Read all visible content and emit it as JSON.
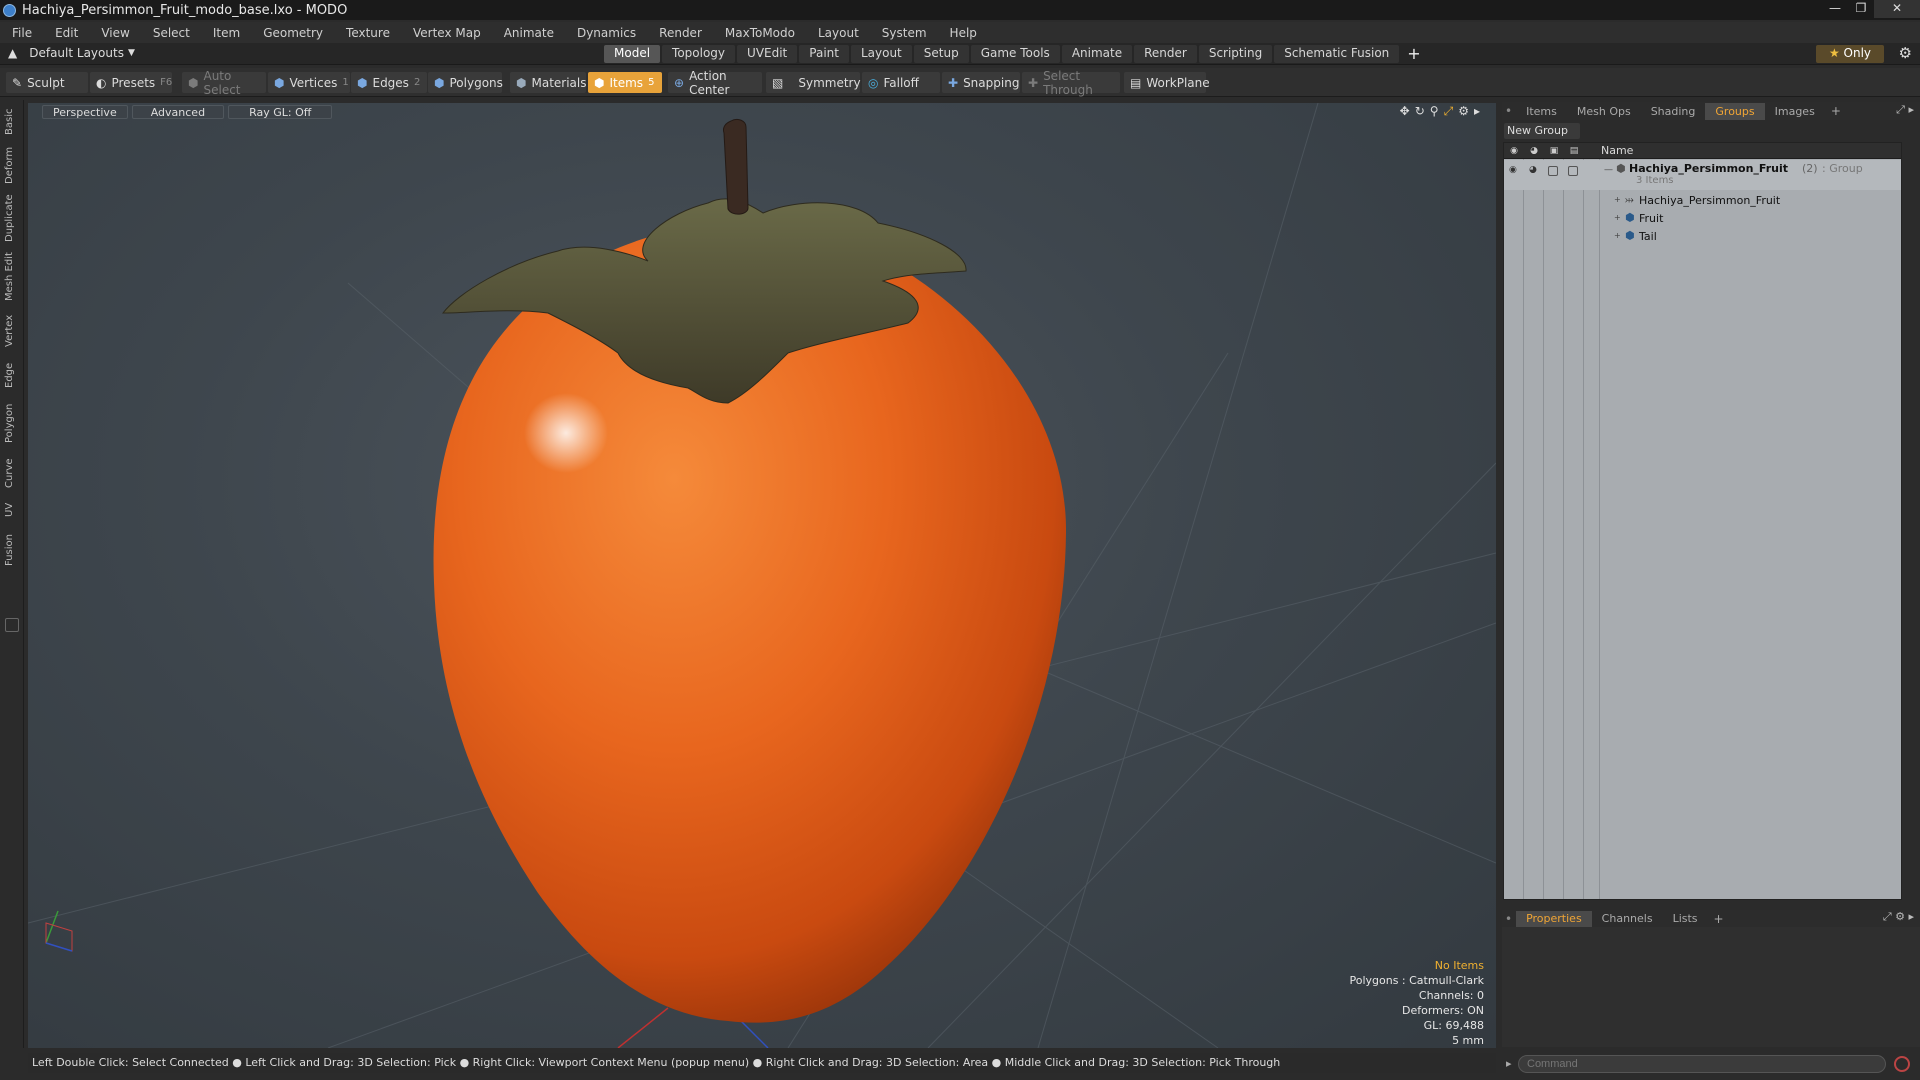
{
  "window": {
    "title": "Hachiya_Persimmon_Fruit_modo_base.lxo - MODO"
  },
  "menu": [
    "File",
    "Edit",
    "View",
    "Select",
    "Item",
    "Geometry",
    "Texture",
    "Vertex Map",
    "Animate",
    "Dynamics",
    "Render",
    "MaxToModo",
    "Layout",
    "System",
    "Help"
  ],
  "layouts": {
    "dropdown": "Default Layouts",
    "tabs": [
      "Model",
      "Topology",
      "UVEdit",
      "Paint",
      "Layout",
      "Setup",
      "Game Tools",
      "Animate",
      "Render",
      "Scripting",
      "Schematic Fusion"
    ],
    "active_tab": "Model",
    "only_label": "Only"
  },
  "toolbar": {
    "sculpt": "Sculpt",
    "presets": "Presets",
    "presets_key": "F6",
    "auto_select": "Auto Select",
    "vertices": "Vertices",
    "vertices_key": "1",
    "edges": "Edges",
    "edges_key": "2",
    "polygons": "Polygons",
    "materials": "Materials",
    "items": "Items",
    "items_key": "5",
    "action_center": "Action Center",
    "symmetry": "Symmetry",
    "falloff": "Falloff",
    "snapping": "Snapping",
    "select_through": "Select Through",
    "workplane": "WorkPlane"
  },
  "left_tabs": [
    "Basic",
    "Deform",
    "Duplicate",
    "Mesh Edit",
    "Vertex",
    "Edge",
    "Polygon",
    "Curve",
    "UV",
    "Fusion"
  ],
  "viewport": {
    "view": "Perspective",
    "mode": "Advanced",
    "raygl": "Ray GL: Off",
    "info": {
      "no_items": "No Items",
      "polygons": "Polygons : Catmull-Clark",
      "channels": "Channels: 0",
      "deformers": "Deformers: ON",
      "gl": "GL: 69,488",
      "scale": "5 mm"
    }
  },
  "statusbar": "Left Double Click: Select Connected ● Left Click and Drag: 3D Selection: Pick ● Right Click: Viewport Context Menu (popup menu) ● Right Click and Drag: 3D Selection: Area ● Middle Click and Drag: 3D Selection: Pick Through",
  "right_panel": {
    "tabs": [
      "Items",
      "Mesh Ops",
      "Shading",
      "Groups",
      "Images"
    ],
    "active_tab": "Groups",
    "new_group": "New Group",
    "name_header": "Name",
    "group": {
      "name": "Hachiya_Persimmon_Fruit",
      "count": "(2)",
      "type": ": Group",
      "items_label": "3 Items"
    },
    "children": [
      "Hachiya_Persimmon_Fruit",
      "Fruit",
      "Tail"
    ]
  },
  "bottom_panel": {
    "tabs": [
      "Properties",
      "Channels",
      "Lists"
    ],
    "active_tab": "Properties"
  },
  "command": {
    "placeholder": "Command"
  },
  "colors": {
    "accent": "#e8a33a",
    "fruit": "#e8661e"
  }
}
